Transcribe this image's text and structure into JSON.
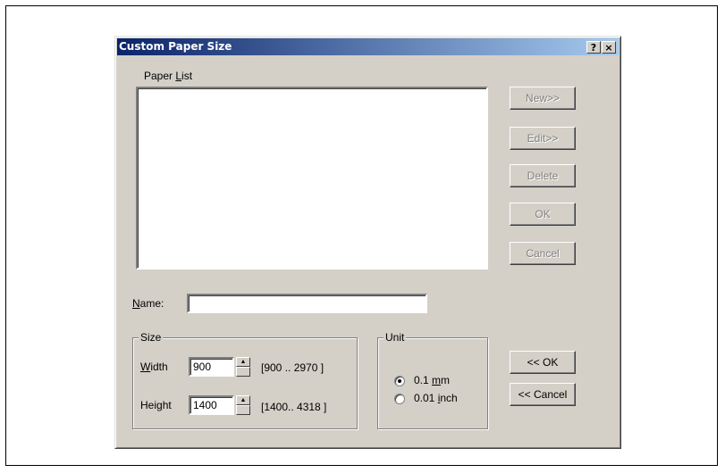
{
  "window": {
    "title": "Custom Paper Size",
    "help_glyph": "?",
    "close_glyph": "×"
  },
  "paper_list": {
    "label_prefix": "Paper ",
    "label_accel": "L",
    "label_suffix": "ist",
    "items": []
  },
  "buttons": {
    "new": "New>>",
    "edit": "Edit>>",
    "delete": "Delete",
    "ok": "OK",
    "cancel": "Cancel",
    "ok_main": "<< OK",
    "cancel_main": "<< Cancel"
  },
  "name": {
    "label_accel": "N",
    "label_suffix": "ame:",
    "value": ""
  },
  "size": {
    "group_label": "Size",
    "width": {
      "label_accel": "W",
      "label_suffix": "idth",
      "value": "900",
      "range": "[900  .. 2970 ]"
    },
    "height": {
      "label_prefix": "Hei",
      "label_accel": "g",
      "label_suffix": "ht",
      "value": "1400",
      "range": "[1400.. 4318 ]"
    }
  },
  "unit": {
    "group_label": "Unit",
    "options": [
      {
        "prefix": "0.1 ",
        "accel": "m",
        "suffix": "m",
        "selected": true
      },
      {
        "prefix": "0.01 ",
        "accel": "i",
        "suffix": "nch",
        "selected": false
      }
    ]
  }
}
